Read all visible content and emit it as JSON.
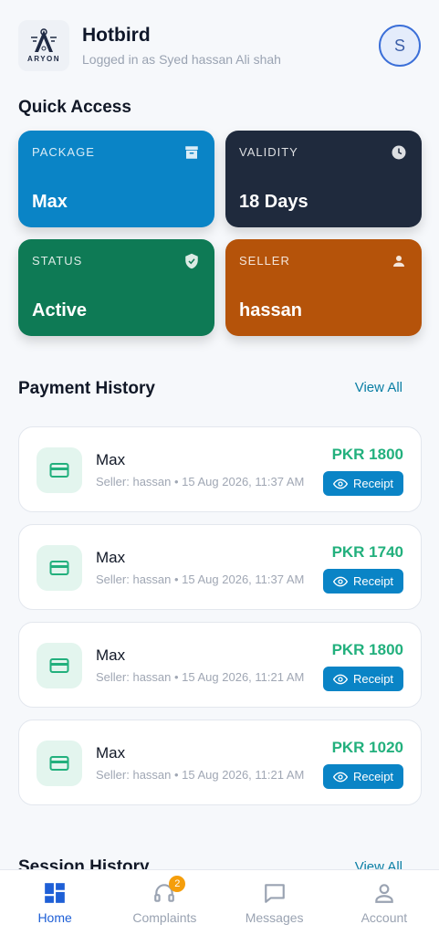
{
  "header": {
    "logo_text": "ARYON",
    "app_title": "Hotbird",
    "subtitle": "Logged in as Syed hassan Ali shah",
    "avatar_initial": "S"
  },
  "quick_access": {
    "title": "Quick Access",
    "tiles": [
      {
        "label": "PACKAGE",
        "value": "Max",
        "color": "#0a84c6",
        "icon": "archive-icon"
      },
      {
        "label": "VALIDITY",
        "value": "18 Days",
        "color": "#1f2a3d",
        "icon": "clock-icon"
      },
      {
        "label": "STATUS",
        "value": "Active",
        "color": "#0e7a55",
        "icon": "shield-check-icon"
      },
      {
        "label": "SELLER",
        "value": "hassan",
        "color": "#b5530a",
        "icon": "person-icon"
      }
    ]
  },
  "payment_history": {
    "title": "Payment History",
    "view_all": "View All",
    "items": [
      {
        "name": "Max",
        "meta": "Seller: hassan • 15 Aug 2026, 11:37 AM",
        "amount": "PKR 1800",
        "receipt": "Receipt"
      },
      {
        "name": "Max",
        "meta": "Seller: hassan • 15 Aug 2026, 11:37 AM",
        "amount": "PKR 1740",
        "receipt": "Receipt"
      },
      {
        "name": "Max",
        "meta": "Seller: hassan • 15 Aug 2026, 11:21 AM",
        "amount": "PKR 1800",
        "receipt": "Receipt"
      },
      {
        "name": "Max",
        "meta": "Seller: hassan • 15 Aug 2026, 11:21 AM",
        "amount": "PKR 1020",
        "receipt": "Receipt"
      }
    ]
  },
  "session_history": {
    "title": "Session History",
    "view_all": "View All"
  },
  "nav": {
    "items": [
      {
        "label": "Home",
        "icon": "dashboard-icon",
        "active": true
      },
      {
        "label": "Complaints",
        "icon": "headset-icon",
        "badge": "2"
      },
      {
        "label": "Messages",
        "icon": "message-icon"
      },
      {
        "label": "Account",
        "icon": "user-icon"
      }
    ]
  },
  "colors": {
    "accent": "#0a84c6",
    "amount_green": "#22b07d",
    "nav_active": "#1e5fd6",
    "badge": "#f59e0b"
  }
}
